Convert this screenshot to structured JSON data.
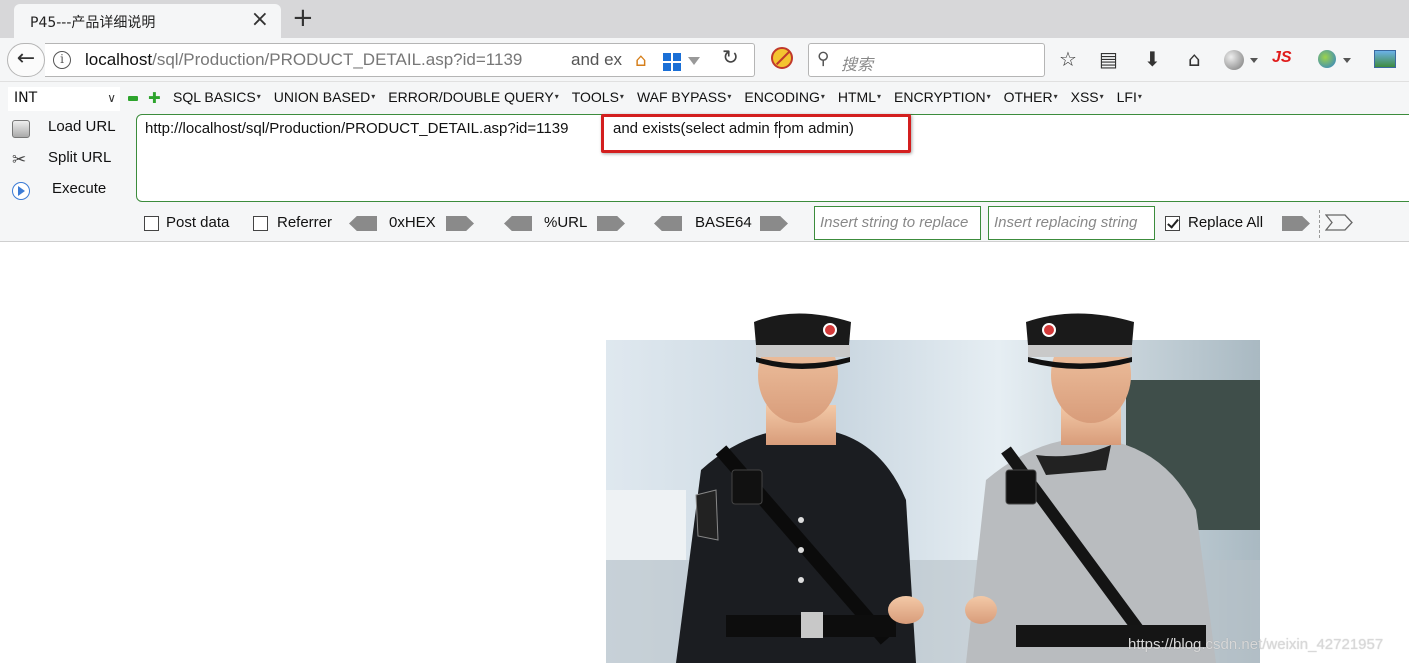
{
  "browser": {
    "tab_title": "P45---产品详细说明",
    "tab_close": "×",
    "new_tab": "+",
    "url_prefix": "localhost",
    "url_path": "/sql/Production/PRODUCT_DETAIL.asp?id=1139",
    "url_overflow": "and ex",
    "search_placeholder": "搜索",
    "js_label": "JS"
  },
  "hackbar": {
    "type_select": "INT",
    "menu": [
      "SQL BASICS",
      "UNION BASED",
      "ERROR/DOUBLE QUERY",
      "TOOLS",
      "WAF BYPASS",
      "ENCODING",
      "HTML",
      "ENCRYPTION",
      "OTHER",
      "XSS",
      "LFI"
    ],
    "load_url": "Load URL",
    "split_url": "Split URL",
    "execute": "Execute",
    "url_value": "http://localhost/sql/Production/PRODUCT_DETAIL.asp?id=1139",
    "injected_value": "and exists(select admin from admin)",
    "post_data": "Post data",
    "referrer": "Referrer",
    "hex_label": "0xHEX",
    "url_enc_label": "%URL",
    "base64_label": "BASE64",
    "replace_from_placeholder": "Insert string to replace",
    "replace_to_placeholder": "Insert replacing string",
    "replace_all": "Replace All",
    "replace_all_checked": true
  },
  "page": {
    "watermark": "https://blog.csdn.net/weixin_42721957"
  },
  "colors": {
    "highlight_box": "#d31f1f",
    "hackbar_green": "#3c8c3c"
  }
}
